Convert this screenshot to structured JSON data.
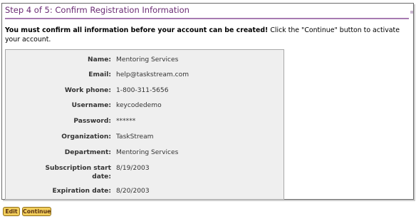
{
  "header": {
    "title": "Step 4 of 5: Confirm Registration Information"
  },
  "intro": {
    "bold_text": "You must confirm all information before your account can be created!",
    "normal_text": " Click the \"Continue\" button to activate your account."
  },
  "fields": [
    {
      "label": "Name:",
      "value": "Mentoring Services"
    },
    {
      "label": "Email:",
      "value": "help@taskstream.com"
    },
    {
      "label": "Work phone:",
      "value": "1-800-311-5656"
    },
    {
      "label": "Username:",
      "value": "keycodedemo"
    },
    {
      "label": "Password:",
      "value": "******"
    },
    {
      "label": "Organization:",
      "value": "TaskStream"
    },
    {
      "label": "Department:",
      "value": "Mentoring Services"
    },
    {
      "label_line1": "Subscription start",
      "label_line2": "date:",
      "value": "8/19/2003"
    },
    {
      "label": "Expiration date:",
      "value": "8/20/2003"
    }
  ],
  "buttons": {
    "edit": "Edit",
    "continue": "Continue"
  },
  "colors": {
    "header_text": "#6a2b74",
    "header_rule": "#a77bb2",
    "panel_border": "#6a6a6a",
    "box_background": "#efefef",
    "button_fill": "#f1cd5a",
    "button_border": "#8f6f1c"
  }
}
